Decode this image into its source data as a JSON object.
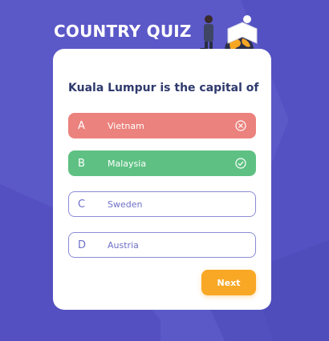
{
  "header": {
    "title": "COUNTRY QUIZ"
  },
  "quiz": {
    "question": "Kuala Lumpur is the capital of",
    "options": [
      {
        "letter": "A",
        "label": "Vietnam",
        "state": "wrong",
        "icon": "x-circle-icon"
      },
      {
        "letter": "B",
        "label": "Malaysia",
        "state": "correct",
        "icon": "check-circle-icon"
      },
      {
        "letter": "C",
        "label": "Sweden",
        "state": "unselected"
      },
      {
        "letter": "D",
        "label": "Austria",
        "state": "unselected"
      }
    ],
    "next_label": "Next"
  },
  "colors": {
    "background": "#5b58c8",
    "wrong": "#eb827d",
    "correct": "#5ec183",
    "accent": "#f9a825",
    "question_text": "#2f3a6d",
    "option_border": "#8b8cd6"
  },
  "illustration": {
    "icon": "traveler-with-globe-illustration"
  }
}
